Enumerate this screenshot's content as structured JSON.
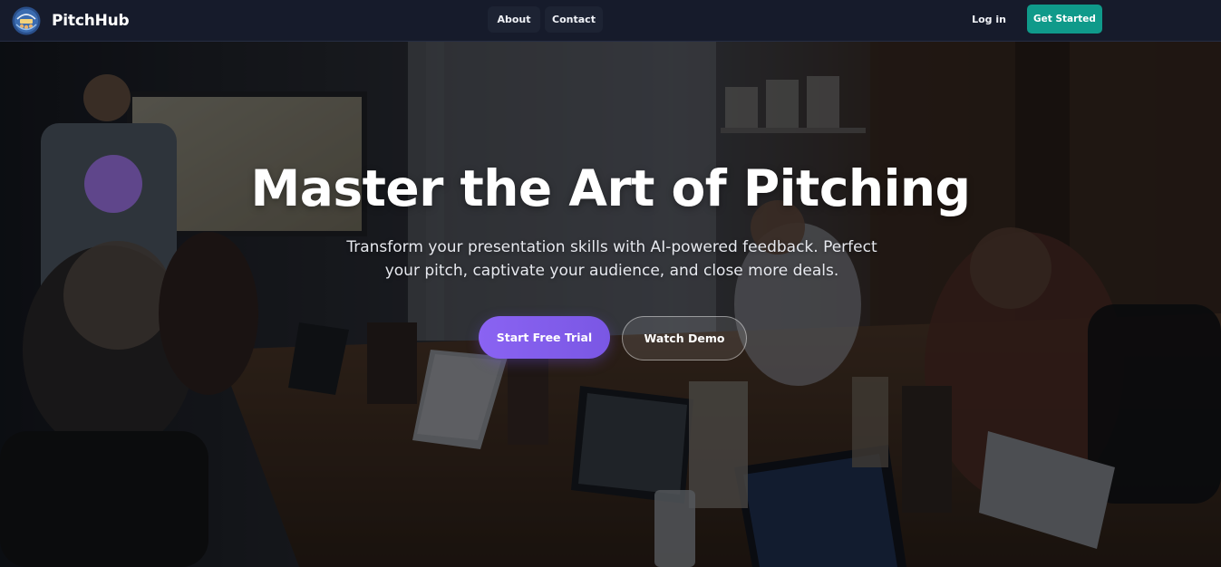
{
  "navbar": {
    "brand_name": "PitchHub",
    "links": {
      "about": "About",
      "contact": "Contact"
    },
    "login_label": "Log in",
    "get_started_label": "Get Started"
  },
  "hero": {
    "title": "Master the Art of Pitching",
    "subtitle": "Transform your presentation skills with AI-powered feedback. Perfect your pitch, captivate your audience, and close more deals.",
    "primary_cta": "Start Free Trial",
    "secondary_cta": "Watch Demo",
    "background_image": "photo: presenter at screen addressing a team around a conference table with laptops"
  },
  "colors": {
    "nav_background": "#161b2b",
    "nav_pill": "#1d2333",
    "get_started": "#0f9a8a",
    "primary_cta_start": "#8a63f2",
    "primary_cta_end": "#7a57e4",
    "accent_blob": "#6a4a9e"
  },
  "icons": {
    "brand_logo": "pitchhub-logo-icon"
  }
}
